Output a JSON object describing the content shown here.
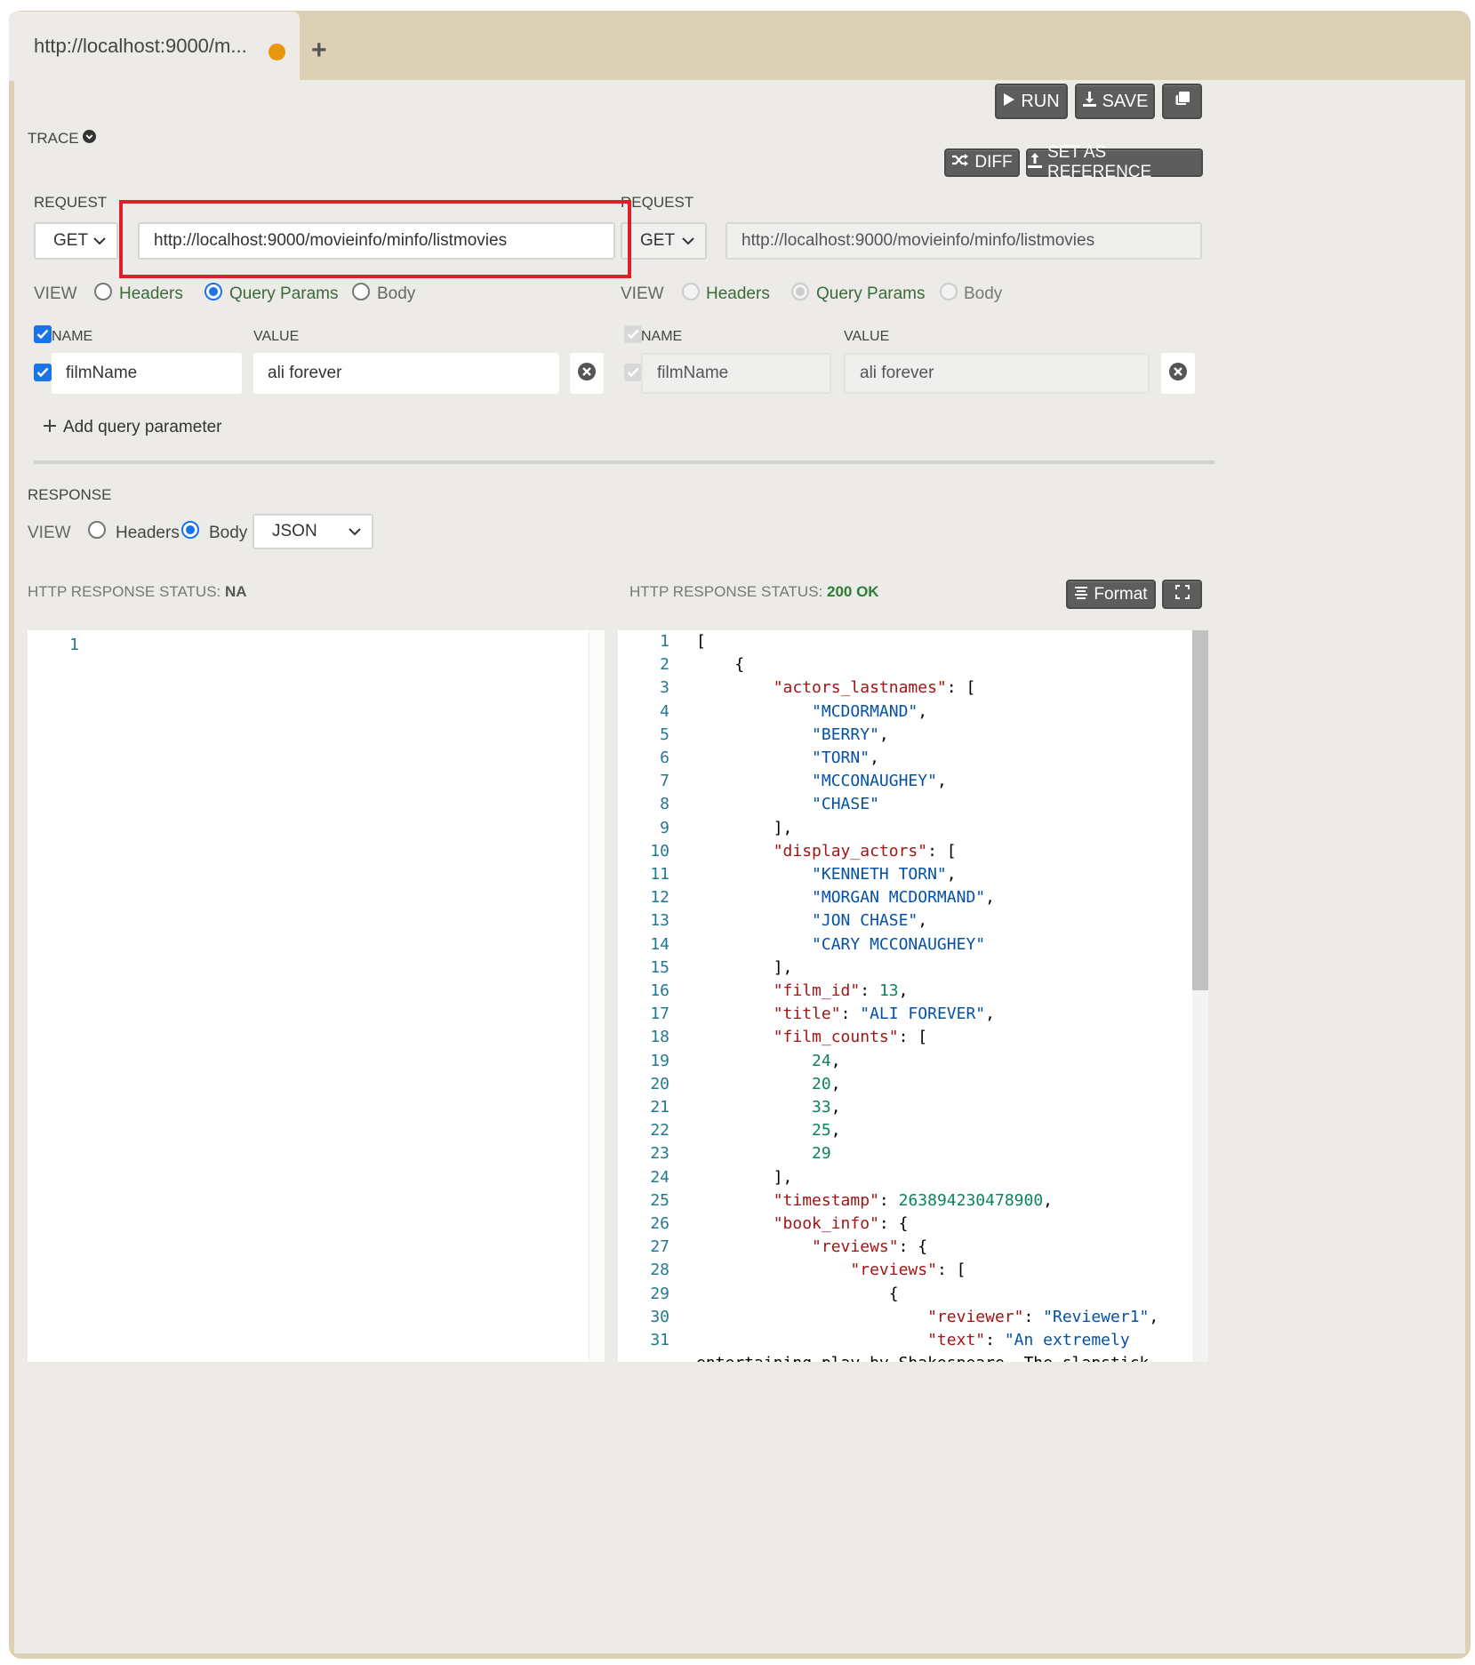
{
  "tab": {
    "title": "http://localhost:9000/m...",
    "add_label": "+"
  },
  "toolbar": {
    "run": "RUN",
    "save": "SAVE",
    "diff": "DIFF",
    "set_reference": "SET AS REFERENCE"
  },
  "trace": {
    "label": "TRACE"
  },
  "left": {
    "request_label": "REQUEST",
    "method": "GET",
    "url": "http://localhost:9000/movieinfo/minfo/listmovies",
    "view_label": "VIEW",
    "views": [
      "Headers",
      "Query Params",
      "Body"
    ],
    "selected_view": "Query Params",
    "params_header": {
      "name": "NAME",
      "value": "VALUE"
    },
    "params": [
      {
        "name": "filmName",
        "value": "ali forever",
        "checked": true
      }
    ],
    "add_param": "Add query parameter"
  },
  "right": {
    "request_label": "REQUEST",
    "method": "GET",
    "url": "http://localhost:9000/movieinfo/minfo/listmovies",
    "view_label": "VIEW",
    "views": [
      "Headers",
      "Query Params",
      "Body"
    ],
    "selected_view": "Query Params",
    "params_header": {
      "name": "NAME",
      "value": "VALUE"
    },
    "params": [
      {
        "name": "filmName",
        "value": "ali forever",
        "checked": true
      }
    ]
  },
  "response": {
    "label": "RESPONSE",
    "view_label": "VIEW",
    "views": [
      "Headers",
      "Body"
    ],
    "selected_view": "Body",
    "format_select": "JSON",
    "left_status_label": "HTTP RESPONSE STATUS:",
    "left_status_value": "NA",
    "right_status_label": "HTTP RESPONSE STATUS:",
    "right_status_value": "200 OK",
    "format_button": "Format"
  },
  "left_editor": {
    "lines": [
      "1"
    ]
  },
  "right_editor": {
    "line_numbers": [
      "1",
      "2",
      "3",
      "4",
      "5",
      "6",
      "7",
      "8",
      "9",
      "10",
      "11",
      "12",
      "13",
      "14",
      "15",
      "16",
      "17",
      "18",
      "19",
      "20",
      "21",
      "22",
      "23",
      "24",
      "25",
      "26",
      "27",
      "28",
      "29",
      "30",
      "31"
    ],
    "code": [
      "[",
      "    {",
      "        \"actors_lastnames\": [",
      "            \"MCDORMAND\",",
      "            \"BERRY\",",
      "            \"TORN\",",
      "            \"MCCONAUGHEY\",",
      "            \"CHASE\"",
      "        ],",
      "        \"display_actors\": [",
      "            \"KENNETH TORN\",",
      "            \"MORGAN MCDORMAND\",",
      "            \"JON CHASE\",",
      "            \"CARY MCCONAUGHEY\"",
      "        ],",
      "        \"film_id\": 13,",
      "        \"title\": \"ALI FOREVER\",",
      "        \"film_counts\": [",
      "            24,",
      "            20,",
      "            33,",
      "            25,",
      "            29",
      "        ],",
      "        \"timestamp\": 263894230478900,",
      "        \"book_info\": {",
      "            \"reviews\": {",
      "                \"reviews\": [",
      "                    {",
      "                        \"reviewer\": \"Reviewer1\",",
      "                        \"text\": \"An extremely"
    ],
    "wrap_line": "entertaining play by Shakespeare. The slapstick"
  },
  "colors": {
    "accent": "#1a73e8",
    "ok": "#2e7d32",
    "highlight": "#e01e27",
    "frame": "#dcd1b5"
  }
}
